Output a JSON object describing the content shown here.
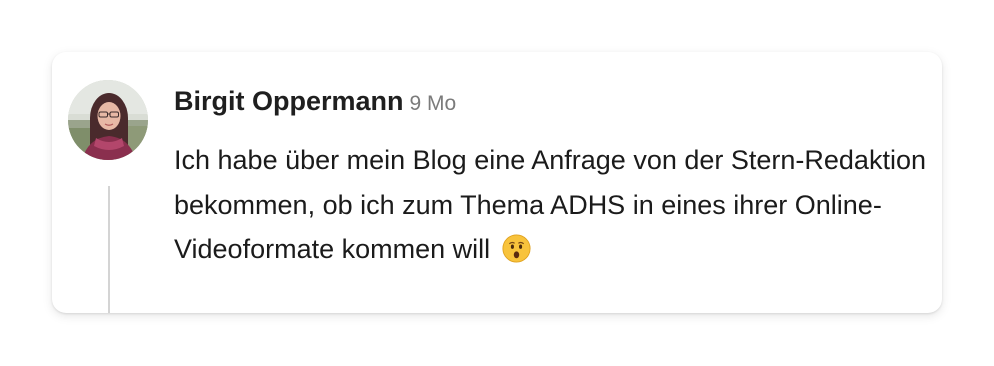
{
  "post": {
    "author": "Birgit Oppermann",
    "time": "9 Mo",
    "text_before_emoji": "Ich habe über mein Blog eine Anfrage von der Stern-Redaktion bekommen, ob ich zum Thema ADHS in eines ihrer Online-Videoformate kommen will ",
    "emoji": "face-with-open-mouth"
  }
}
